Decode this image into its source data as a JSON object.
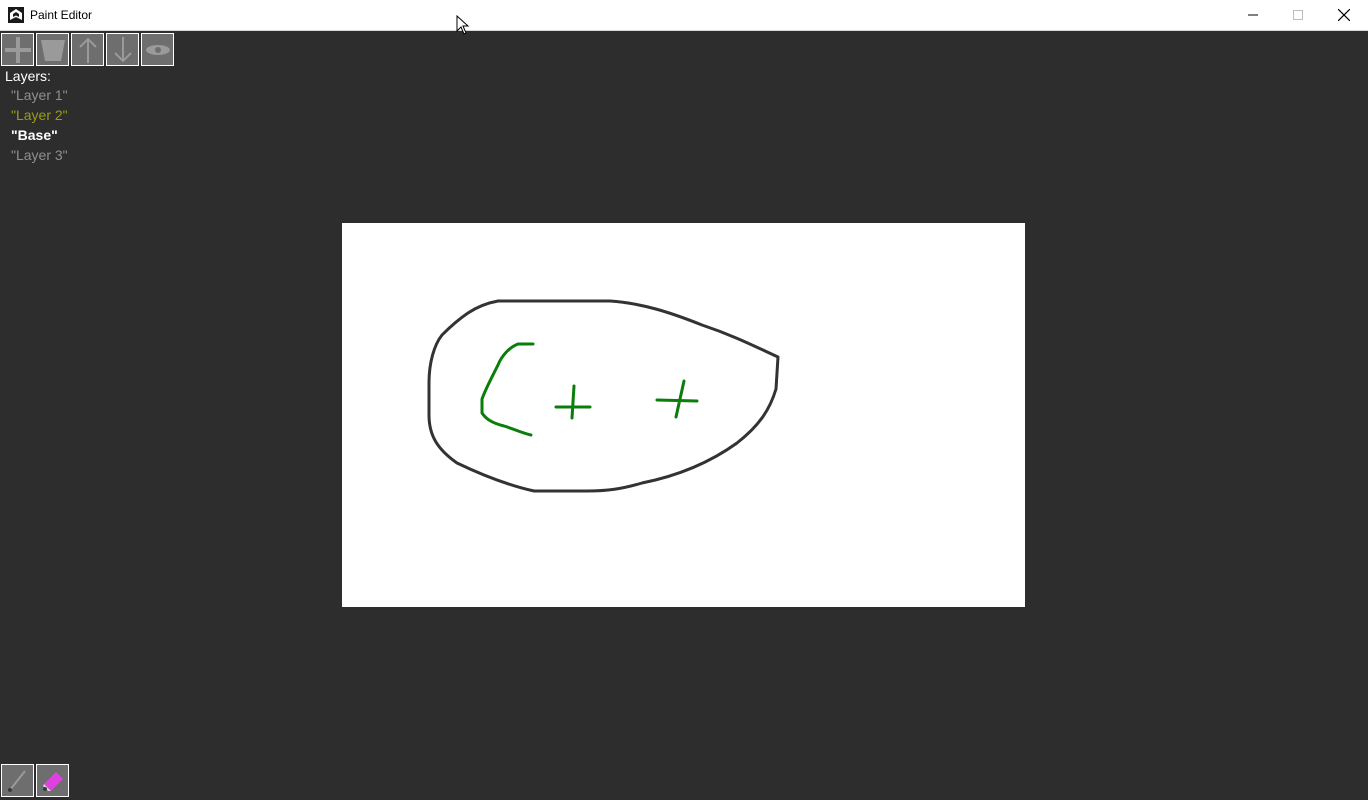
{
  "window": {
    "title": "Paint Editor"
  },
  "toolbar": {
    "buttons": [
      {
        "name": "add-layer-button",
        "icon": "plus-icon"
      },
      {
        "name": "delete-layer-button",
        "icon": "trash-icon"
      },
      {
        "name": "move-layer-up-button",
        "icon": "arrow-up-icon"
      },
      {
        "name": "move-layer-down-button",
        "icon": "arrow-down-icon"
      },
      {
        "name": "toggle-visibility-button",
        "icon": "eye-icon"
      }
    ]
  },
  "layers": {
    "title": "Layers:",
    "items": [
      {
        "label": "\"Layer 1\"",
        "state": "dim"
      },
      {
        "label": "\"Layer 2\"",
        "state": "selected"
      },
      {
        "label": "\"Base\"",
        "state": "active"
      },
      {
        "label": "\"Layer 3\"",
        "state": "dim"
      }
    ]
  },
  "tools": [
    {
      "name": "brush-tool-button",
      "icon": "brush-icon"
    },
    {
      "name": "eraser-tool-button",
      "icon": "eraser-icon"
    }
  ],
  "colors": {
    "background": "#2d2d2d",
    "canvas": "#ffffff",
    "button_bg": "#6e6e6e",
    "layer_dim": "#8f8f8f",
    "layer_selected": "#9c9a17",
    "layer_active": "#ffffff",
    "stroke_dark": "#333333",
    "stroke_green": "#0a7d0a",
    "eraser_pink": "#e040e0"
  }
}
